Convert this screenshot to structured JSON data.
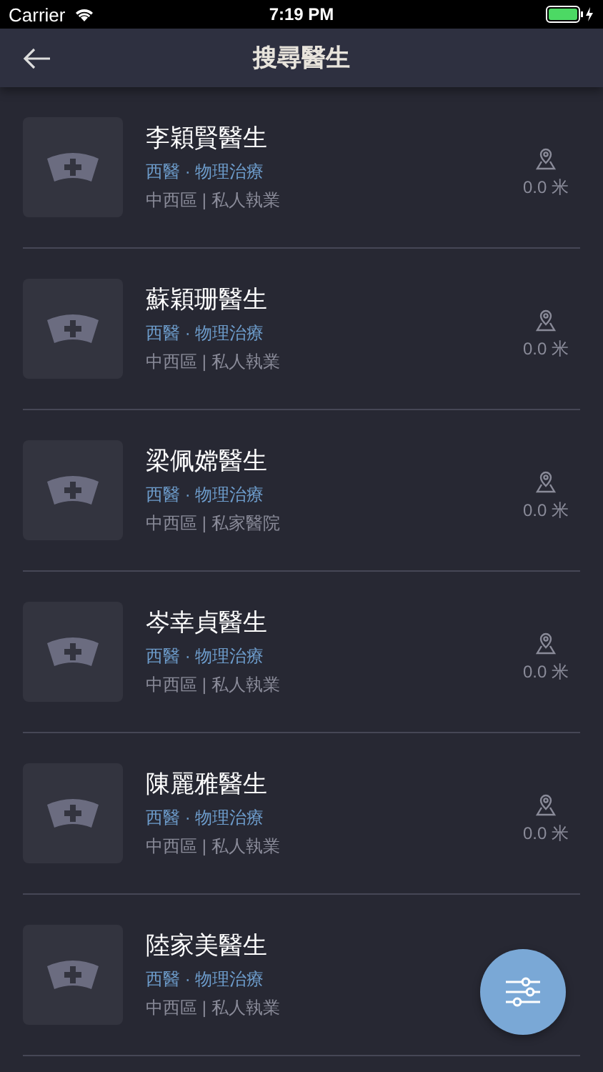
{
  "status_bar": {
    "carrier": "Carrier",
    "time": "7:19 PM"
  },
  "nav": {
    "title": "搜尋醫生"
  },
  "doctors": [
    {
      "name": "李穎賢醫生",
      "specialty": "西醫 · 物理治療",
      "location": "中西區 | 私人執業",
      "distance": "0.0 米"
    },
    {
      "name": "蘇穎珊醫生",
      "specialty": "西醫 · 物理治療",
      "location": "中西區 | 私人執業",
      "distance": "0.0 米"
    },
    {
      "name": "梁佩嫦醫生",
      "specialty": "西醫 · 物理治療",
      "location": "中西區 | 私家醫院",
      "distance": "0.0 米"
    },
    {
      "name": "岑幸貞醫生",
      "specialty": "西醫 · 物理治療",
      "location": "中西區 | 私人執業",
      "distance": "0.0 米"
    },
    {
      "name": "陳麗雅醫生",
      "specialty": "西醫 · 物理治療",
      "location": "中西區 | 私人執業",
      "distance": "0.0 米"
    },
    {
      "name": "陸家美醫生",
      "specialty": "西醫 · 物理治療",
      "location": "中西區 | 私人執業"
    }
  ]
}
